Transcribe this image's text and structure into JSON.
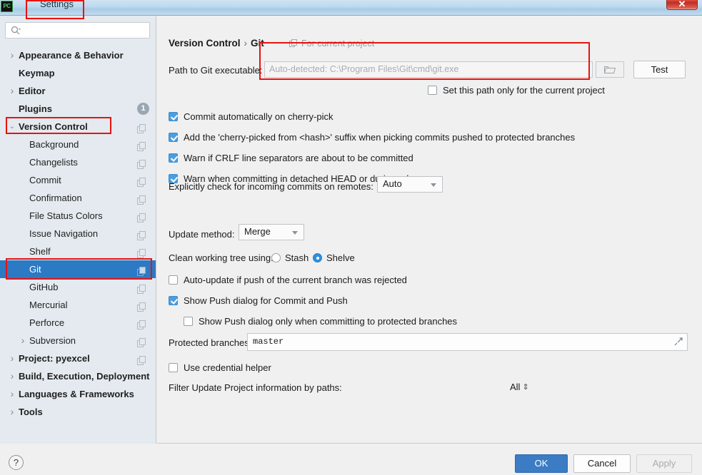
{
  "window": {
    "title": "Settings",
    "app_icon": "pycharm-icon",
    "close_label": "✕"
  },
  "sidebar": {
    "search": {
      "value": "",
      "placeholder": "",
      "icon": "search-icon"
    },
    "items": [
      {
        "label": "Appearance & Behavior",
        "level": 0,
        "arrow": "collapsed",
        "bold": true,
        "badge": "",
        "copy": false,
        "selected": false
      },
      {
        "label": "Keymap",
        "level": 0,
        "arrow": "none",
        "bold": true,
        "badge": "",
        "copy": false,
        "selected": false
      },
      {
        "label": "Editor",
        "level": 0,
        "arrow": "collapsed",
        "bold": true,
        "badge": "",
        "copy": false,
        "selected": false
      },
      {
        "label": "Plugins",
        "level": 0,
        "arrow": "none",
        "bold": true,
        "badge": "1",
        "copy": false,
        "selected": false
      },
      {
        "label": "Version Control",
        "level": 0,
        "arrow": "expanded",
        "bold": true,
        "badge": "",
        "copy": true,
        "selected": false
      },
      {
        "label": "Background",
        "level": 1,
        "arrow": "none",
        "bold": false,
        "badge": "",
        "copy": true,
        "selected": false
      },
      {
        "label": "Changelists",
        "level": 1,
        "arrow": "none",
        "bold": false,
        "badge": "",
        "copy": true,
        "selected": false
      },
      {
        "label": "Commit",
        "level": 1,
        "arrow": "none",
        "bold": false,
        "badge": "",
        "copy": true,
        "selected": false
      },
      {
        "label": "Confirmation",
        "level": 1,
        "arrow": "none",
        "bold": false,
        "badge": "",
        "copy": true,
        "selected": false
      },
      {
        "label": "File Status Colors",
        "level": 1,
        "arrow": "none",
        "bold": false,
        "badge": "",
        "copy": true,
        "selected": false
      },
      {
        "label": "Issue Navigation",
        "level": 1,
        "arrow": "none",
        "bold": false,
        "badge": "",
        "copy": true,
        "selected": false
      },
      {
        "label": "Shelf",
        "level": 1,
        "arrow": "none",
        "bold": false,
        "badge": "",
        "copy": true,
        "selected": false
      },
      {
        "label": "Git",
        "level": 1,
        "arrow": "none",
        "bold": false,
        "badge": "",
        "copy": true,
        "selected": true
      },
      {
        "label": "GitHub",
        "level": 1,
        "arrow": "none",
        "bold": false,
        "badge": "",
        "copy": true,
        "selected": false
      },
      {
        "label": "Mercurial",
        "level": 1,
        "arrow": "none",
        "bold": false,
        "badge": "",
        "copy": true,
        "selected": false
      },
      {
        "label": "Perforce",
        "level": 1,
        "arrow": "none",
        "bold": false,
        "badge": "",
        "copy": true,
        "selected": false
      },
      {
        "label": "Subversion",
        "level": 1,
        "arrow": "collapsed",
        "bold": false,
        "badge": "",
        "copy": true,
        "selected": false
      },
      {
        "label": "Project: pyexcel",
        "level": 0,
        "arrow": "collapsed",
        "bold": true,
        "badge": "",
        "copy": true,
        "selected": false
      },
      {
        "label": "Build, Execution, Deployment",
        "level": 0,
        "arrow": "collapsed",
        "bold": true,
        "badge": "",
        "copy": false,
        "selected": false
      },
      {
        "label": "Languages & Frameworks",
        "level": 0,
        "arrow": "collapsed",
        "bold": true,
        "badge": "",
        "copy": false,
        "selected": false
      },
      {
        "label": "Tools",
        "level": 0,
        "arrow": "collapsed",
        "bold": true,
        "badge": "",
        "copy": false,
        "selected": false
      }
    ]
  },
  "main": {
    "breadcrumb_root": "Version Control",
    "breadcrumb_sep": "›",
    "breadcrumb_leaf": "Git",
    "for_current_project": "For current project",
    "for_current_project_icon": "copy-icon",
    "path_label": "Path to Git executable:",
    "path_value": "",
    "path_placeholder": "Auto-detected: C:\\Program Files\\Git\\cmd\\git.exe",
    "browse_icon": "folder-icon",
    "test_button": "Test",
    "set_path_only_label": "Set this path only for the current project",
    "set_path_only_checked": false,
    "checkboxes": [
      {
        "label": "Commit automatically on cherry-pick",
        "checked": true
      },
      {
        "label": "Add the 'cherry-picked from <hash>' suffix when picking commits pushed to protected branches",
        "checked": true
      },
      {
        "label": "Warn if CRLF line separators are about to be committed",
        "checked": true
      },
      {
        "label": "Warn when committing in detached HEAD or during rebase",
        "checked": true
      }
    ],
    "incoming_label": "Explicitly check for incoming commits on remotes:",
    "incoming_value": "Auto",
    "update_method_label": "Update method:",
    "update_method_value": "Merge",
    "clean_tree_label": "Clean working tree using:",
    "clean_tree_options": [
      {
        "label": "Stash",
        "selected": false
      },
      {
        "label": "Shelve",
        "selected": true
      }
    ],
    "auto_update_label": "Auto-update if push of the current branch was rejected",
    "auto_update_checked": false,
    "show_push_label": "Show Push dialog for Commit and Push",
    "show_push_checked": true,
    "show_push_protected_label": "Show Push dialog only when committing to protected branches",
    "show_push_protected_checked": false,
    "protected_branches_label": "Protected branches:",
    "protected_branches_value": "master",
    "expand_icon": "expand-icon",
    "credential_helper_label": "Use credential helper",
    "credential_helper_checked": false,
    "filter_paths_label": "Filter Update Project information by paths:",
    "filter_paths_value": "All"
  },
  "footer": {
    "help_label": "?",
    "ok_label": "OK",
    "cancel_label": "Cancel",
    "apply_label": "Apply"
  },
  "colors": {
    "accent_blue": "#3b7cc4",
    "selection_blue": "#2c79c4",
    "annotation_red": "#e8130f",
    "checkbox_blue": "#4a9de0"
  }
}
